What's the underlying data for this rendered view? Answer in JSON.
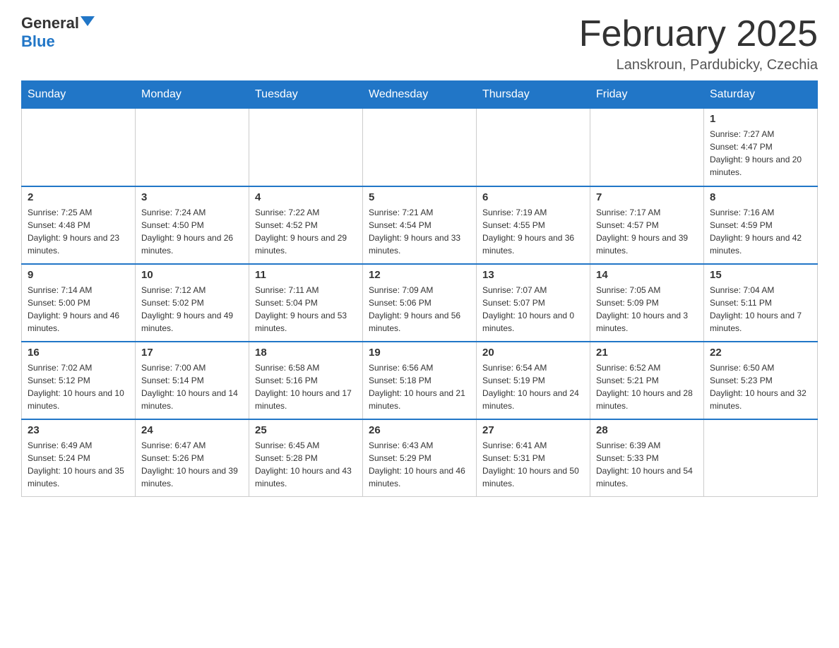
{
  "header": {
    "logo_general": "General",
    "logo_blue": "Blue",
    "month_title": "February 2025",
    "location": "Lanskroun, Pardubicky, Czechia"
  },
  "weekdays": [
    "Sunday",
    "Monday",
    "Tuesday",
    "Wednesday",
    "Thursday",
    "Friday",
    "Saturday"
  ],
  "weeks": [
    [
      {
        "day": "",
        "info": ""
      },
      {
        "day": "",
        "info": ""
      },
      {
        "day": "",
        "info": ""
      },
      {
        "day": "",
        "info": ""
      },
      {
        "day": "",
        "info": ""
      },
      {
        "day": "",
        "info": ""
      },
      {
        "day": "1",
        "info": "Sunrise: 7:27 AM\nSunset: 4:47 PM\nDaylight: 9 hours and 20 minutes."
      }
    ],
    [
      {
        "day": "2",
        "info": "Sunrise: 7:25 AM\nSunset: 4:48 PM\nDaylight: 9 hours and 23 minutes."
      },
      {
        "day": "3",
        "info": "Sunrise: 7:24 AM\nSunset: 4:50 PM\nDaylight: 9 hours and 26 minutes."
      },
      {
        "day": "4",
        "info": "Sunrise: 7:22 AM\nSunset: 4:52 PM\nDaylight: 9 hours and 29 minutes."
      },
      {
        "day": "5",
        "info": "Sunrise: 7:21 AM\nSunset: 4:54 PM\nDaylight: 9 hours and 33 minutes."
      },
      {
        "day": "6",
        "info": "Sunrise: 7:19 AM\nSunset: 4:55 PM\nDaylight: 9 hours and 36 minutes."
      },
      {
        "day": "7",
        "info": "Sunrise: 7:17 AM\nSunset: 4:57 PM\nDaylight: 9 hours and 39 minutes."
      },
      {
        "day": "8",
        "info": "Sunrise: 7:16 AM\nSunset: 4:59 PM\nDaylight: 9 hours and 42 minutes."
      }
    ],
    [
      {
        "day": "9",
        "info": "Sunrise: 7:14 AM\nSunset: 5:00 PM\nDaylight: 9 hours and 46 minutes."
      },
      {
        "day": "10",
        "info": "Sunrise: 7:12 AM\nSunset: 5:02 PM\nDaylight: 9 hours and 49 minutes."
      },
      {
        "day": "11",
        "info": "Sunrise: 7:11 AM\nSunset: 5:04 PM\nDaylight: 9 hours and 53 minutes."
      },
      {
        "day": "12",
        "info": "Sunrise: 7:09 AM\nSunset: 5:06 PM\nDaylight: 9 hours and 56 minutes."
      },
      {
        "day": "13",
        "info": "Sunrise: 7:07 AM\nSunset: 5:07 PM\nDaylight: 10 hours and 0 minutes."
      },
      {
        "day": "14",
        "info": "Sunrise: 7:05 AM\nSunset: 5:09 PM\nDaylight: 10 hours and 3 minutes."
      },
      {
        "day": "15",
        "info": "Sunrise: 7:04 AM\nSunset: 5:11 PM\nDaylight: 10 hours and 7 minutes."
      }
    ],
    [
      {
        "day": "16",
        "info": "Sunrise: 7:02 AM\nSunset: 5:12 PM\nDaylight: 10 hours and 10 minutes."
      },
      {
        "day": "17",
        "info": "Sunrise: 7:00 AM\nSunset: 5:14 PM\nDaylight: 10 hours and 14 minutes."
      },
      {
        "day": "18",
        "info": "Sunrise: 6:58 AM\nSunset: 5:16 PM\nDaylight: 10 hours and 17 minutes."
      },
      {
        "day": "19",
        "info": "Sunrise: 6:56 AM\nSunset: 5:18 PM\nDaylight: 10 hours and 21 minutes."
      },
      {
        "day": "20",
        "info": "Sunrise: 6:54 AM\nSunset: 5:19 PM\nDaylight: 10 hours and 24 minutes."
      },
      {
        "day": "21",
        "info": "Sunrise: 6:52 AM\nSunset: 5:21 PM\nDaylight: 10 hours and 28 minutes."
      },
      {
        "day": "22",
        "info": "Sunrise: 6:50 AM\nSunset: 5:23 PM\nDaylight: 10 hours and 32 minutes."
      }
    ],
    [
      {
        "day": "23",
        "info": "Sunrise: 6:49 AM\nSunset: 5:24 PM\nDaylight: 10 hours and 35 minutes."
      },
      {
        "day": "24",
        "info": "Sunrise: 6:47 AM\nSunset: 5:26 PM\nDaylight: 10 hours and 39 minutes."
      },
      {
        "day": "25",
        "info": "Sunrise: 6:45 AM\nSunset: 5:28 PM\nDaylight: 10 hours and 43 minutes."
      },
      {
        "day": "26",
        "info": "Sunrise: 6:43 AM\nSunset: 5:29 PM\nDaylight: 10 hours and 46 minutes."
      },
      {
        "day": "27",
        "info": "Sunrise: 6:41 AM\nSunset: 5:31 PM\nDaylight: 10 hours and 50 minutes."
      },
      {
        "day": "28",
        "info": "Sunrise: 6:39 AM\nSunset: 5:33 PM\nDaylight: 10 hours and 54 minutes."
      },
      {
        "day": "",
        "info": ""
      }
    ]
  ]
}
